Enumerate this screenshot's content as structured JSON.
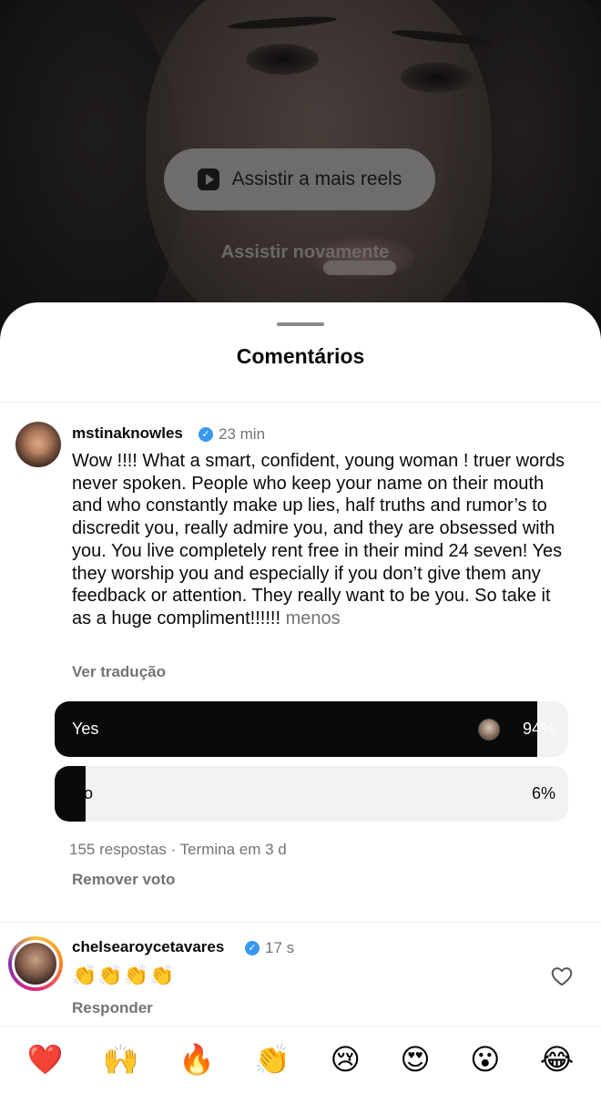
{
  "video": {
    "watch_more_label": "Assistir a mais reels",
    "watch_again_label": "Assistir novamente"
  },
  "sheet": {
    "title": "Comentários"
  },
  "comments": [
    {
      "username": "mstinaknowles",
      "verified": true,
      "time": "23 min",
      "text": "Wow !!!! What a smart, confident, young woman ! truer words never spoken. People who keep your name  on their  mouth and who constantly make up lies, half truths  and rumor’s  to discredit you, really admire you, and they are obsessed with you. You live completely rent free in their mind 24 seven!  Yes they worship you and especially if you don’t give them any feedback or attention. They really want to be you.  So take it  as a huge compliment!!!!!! ",
      "less_label": "menos",
      "translate_label": "Ver tradução",
      "poll": {
        "options": [
          {
            "label": "Yes",
            "percent_text": "94%",
            "fraction": 0.94
          },
          {
            "label": "No",
            "percent_text": "6%",
            "fraction": 0.06
          }
        ],
        "meta": "155 respostas · Termina em 3 d",
        "remove_vote_label": "Remover voto"
      }
    },
    {
      "username": "chelsearoycetavares",
      "verified": true,
      "time": "17 s",
      "text": "👏👏👏👏",
      "reply_label": "Responder"
    }
  ],
  "reactions": [
    "❤️",
    "🙌",
    "🔥",
    "👏",
    "😢",
    "😍",
    "😮",
    "😂"
  ],
  "icons": {
    "play": "play-icon",
    "verified": "verified-badge-icon",
    "like": "heart-outline-icon"
  }
}
